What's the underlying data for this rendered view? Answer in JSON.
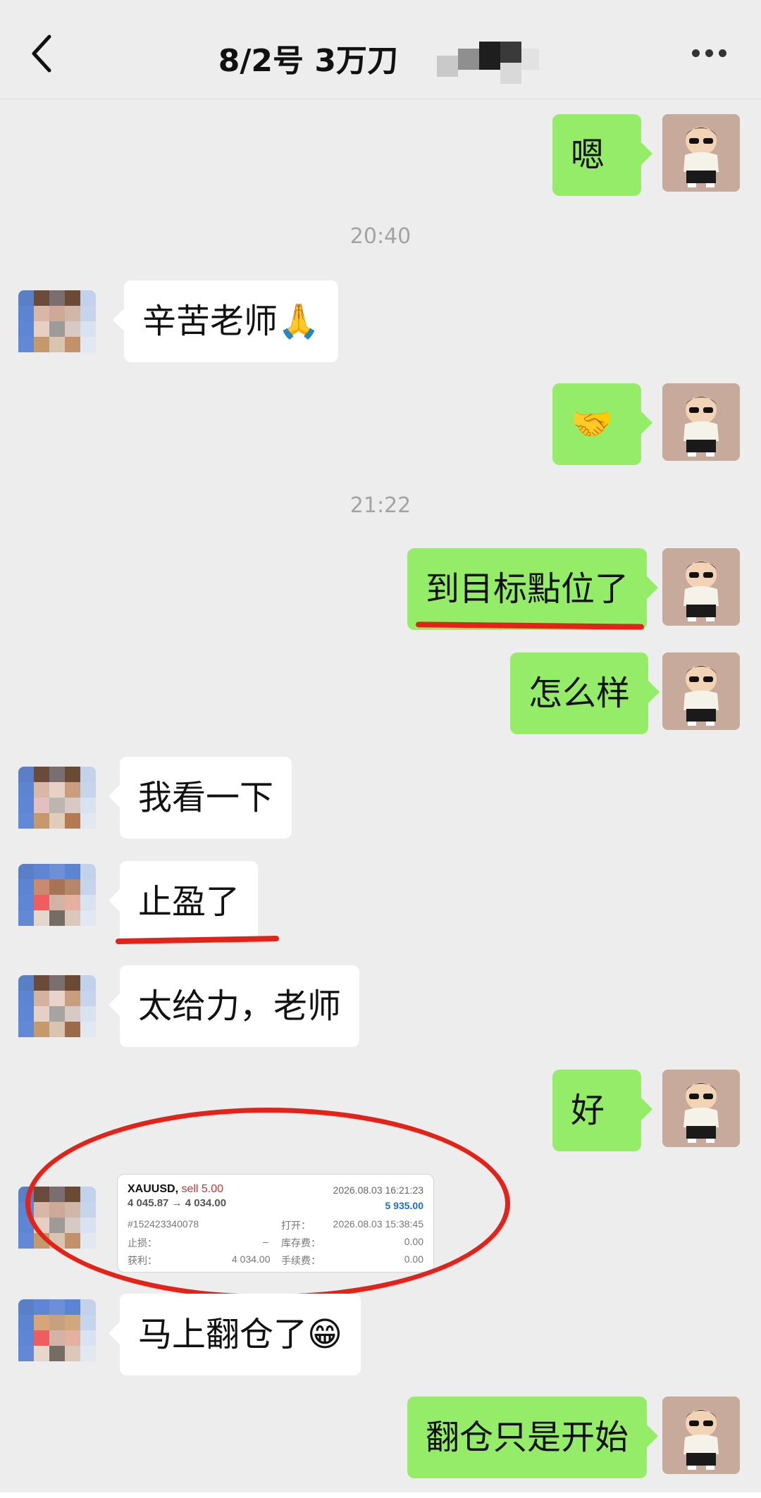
{
  "header": {
    "title": "8/2号  3万刀",
    "back_icon": "chevron-left-icon",
    "more_icon": "more-dots-icon"
  },
  "messages": [
    {
      "from": "me",
      "text": "嗯"
    },
    {
      "time": "20:40"
    },
    {
      "from": "peer",
      "text": "辛苦老师🙏"
    },
    {
      "from": "me",
      "text": "🤝"
    },
    {
      "time": "21:22"
    },
    {
      "from": "me",
      "text": "到目标點位了"
    },
    {
      "from": "me",
      "text": "怎么样"
    },
    {
      "from": "peer",
      "text": "我看一下"
    },
    {
      "from": "peer",
      "text": "止盈了"
    },
    {
      "from": "peer",
      "text": "太给力，老师"
    },
    {
      "from": "me",
      "text": "好"
    },
    {
      "from": "peer",
      "type": "trade-card"
    },
    {
      "from": "peer",
      "text": "马上翻仓了😁"
    },
    {
      "from": "me",
      "text": "翻仓只是开始"
    }
  ],
  "trade_card": {
    "symbol": "XAUUSD,",
    "action": "sell 5.00",
    "price_line": "4 045.87 → 4 034.00",
    "close_time": "2026.08.03 16:21:23",
    "profit": "5 935.00",
    "order_id": "#152423340078",
    "open_label": "打开：",
    "open_time": "2026.08.03 15:38:45",
    "sl_label": "止损：",
    "sl_value": "–",
    "swap_label": "库存费：",
    "swap_value": "0.00",
    "tp_label": "获利：",
    "tp_value": "4 034.00",
    "fee_label": "手续费：",
    "fee_value": "0.00"
  },
  "colors": {
    "me_bubble": "#95ec69",
    "peer_bubble": "#ffffff",
    "background": "#ededed",
    "annotation_red": "#e3231a",
    "profit_blue": "#1a6fc4",
    "sell_red": "#d0312d"
  }
}
